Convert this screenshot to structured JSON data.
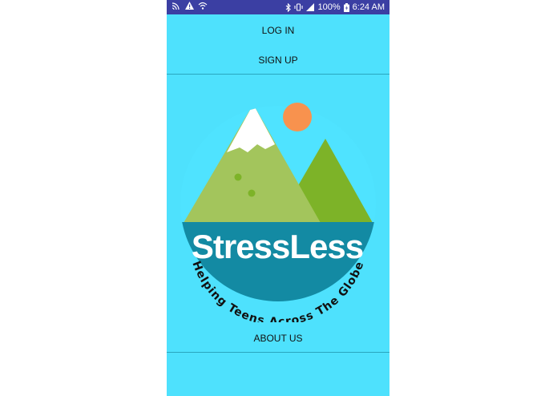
{
  "status_bar": {
    "battery": "100%",
    "time": "6:24 AM",
    "icons": [
      "cast-icon",
      "warning-icon",
      "wifi-calling-icon",
      "bluetooth-icon",
      "vibrate-icon",
      "signal-icon",
      "battery-charging-icon"
    ]
  },
  "menu": {
    "login_label": "LOG IN",
    "signup_label": "SIGN UP",
    "about_label": "ABOUT US"
  },
  "logo": {
    "title": "StressLess",
    "tagline": "Helping Teens Across The Globe"
  },
  "colors": {
    "background": "#4ee1fd",
    "status_bar": "#3b3fa3",
    "water": "#138aa3",
    "mountain_left": "#a3c55c",
    "mountain_right": "#7db328",
    "snow": "#ffffff",
    "sun": "#f8924e"
  }
}
